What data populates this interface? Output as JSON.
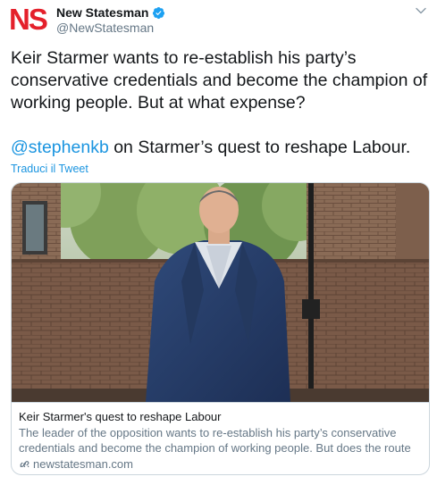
{
  "author": {
    "logo_text": "NS",
    "display_name": "New Statesman",
    "handle": "@NewStatesman",
    "verified": true
  },
  "tweet": {
    "text": "Keir Starmer wants to re-establish his party’s conservative credentials and become the champion of working people. But at what expense?",
    "mention": "@stephenkb",
    "text_after_mention": " on Starmer’s quest to reshape Labour.",
    "translate_label": "Traduci il Tweet"
  },
  "card": {
    "title": "Keir Starmer's quest to reshape Labour",
    "description": "The leader of the opposition wants to re-establish his party’s conservative credentials and become the champion of working people. But does the route …",
    "domain": "newstatesman.com"
  },
  "icons": {
    "verified": "verified-badge-icon",
    "caret": "chevron-down-icon",
    "link": "link-icon"
  },
  "colors": {
    "brand_red": "#e4202b",
    "link_blue": "#1b95e0",
    "verified_blue": "#1da1f2",
    "secondary_text": "#657786"
  }
}
